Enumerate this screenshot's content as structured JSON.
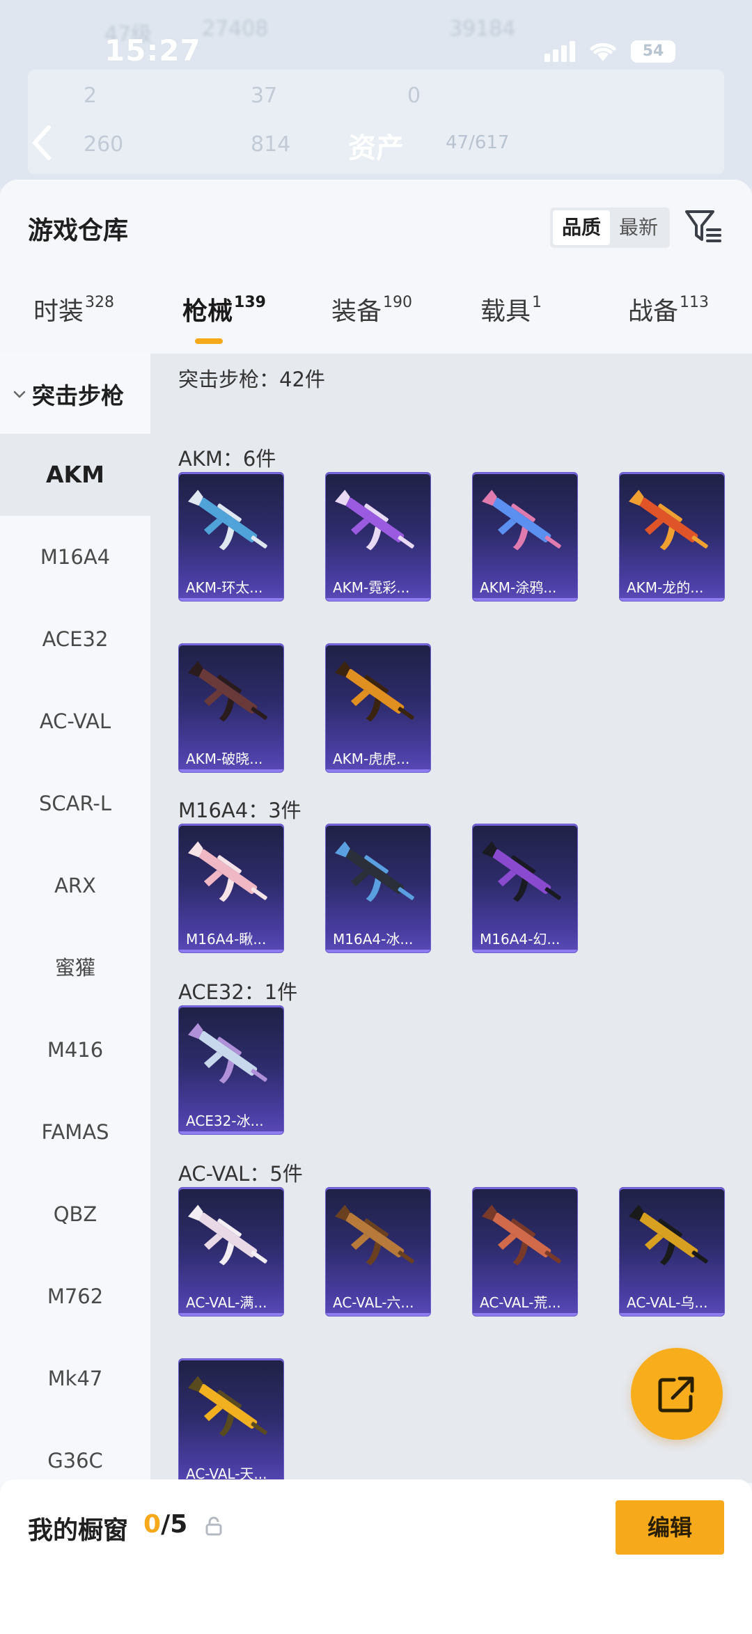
{
  "backdrop": {
    "faded_texts": [
      "47级",
      "27408",
      "39184",
      "2",
      "37",
      "0",
      "260",
      "814"
    ],
    "asset_title": "资产",
    "asset_count": "47/617"
  },
  "status_bar": {
    "time": "15:27",
    "battery": "54"
  },
  "warehouse": {
    "title": "游戏仓库",
    "sort_options": [
      "品质",
      "最新"
    ],
    "active_sort": "品质"
  },
  "tabs": [
    {
      "label": "时装",
      "count": "328"
    },
    {
      "label": "枪械",
      "count": "139"
    },
    {
      "label": "装备",
      "count": "190"
    },
    {
      "label": "载具",
      "count": "1"
    },
    {
      "label": "战备",
      "count": "113"
    }
  ],
  "sidebar": {
    "category": "突击步枪",
    "items": [
      "AKM",
      "M16A4",
      "ACE32",
      "AC-VAL",
      "SCAR-L",
      "ARX",
      "蜜獾",
      "M416",
      "FAMAS",
      "QBZ",
      "M762",
      "Mk47",
      "G36C"
    ]
  },
  "main": {
    "summary": "突击步枪：42件",
    "sections": [
      {
        "label": "AKM：6件",
        "items": [
          "AKM-环太...",
          "AKM-霓彩...",
          "AKM-涂鸦...",
          "AKM-龙的...",
          "AKM-破晓...",
          "AKM-虎虎..."
        ]
      },
      {
        "label": "M16A4：3件",
        "items": [
          "M16A4-瞅...",
          "M16A4-冰...",
          "M16A4-幻..."
        ]
      },
      {
        "label": "ACE32：1件",
        "items": [
          "ACE32-冰..."
        ]
      },
      {
        "label": "AC-VAL：5件",
        "items": [
          "AC-VAL-满...",
          "AC-VAL-六...",
          "AC-VAL-荒...",
          "AC-VAL-乌...",
          "AC-VAL-天..."
        ]
      }
    ]
  },
  "gun_colors": {
    "AKM-环太...": [
      "#4fa3d9",
      "#dfe8f0"
    ],
    "AKM-霓彩...": [
      "#9b5be0",
      "#e8d9f5"
    ],
    "AKM-涂鸦...": [
      "#5b8ff0",
      "#e07bb0"
    ],
    "AKM-龙的...": [
      "#e0542a",
      "#f0a030"
    ],
    "AKM-破晓...": [
      "#6a3a3a",
      "#2a1c1c"
    ],
    "AKM-虎虎...": [
      "#e09020",
      "#3a2410"
    ],
    "M16A4-瞅...": [
      "#f0b7c5",
      "#f6e3e8"
    ],
    "M16A4-冰...": [
      "#2a2f3a",
      "#5aa0e0"
    ],
    "M16A4-幻...": [
      "#8a4ad0",
      "#1a1a22"
    ],
    "ACE32-冰...": [
      "#c8d8ec",
      "#b090d8"
    ],
    "AC-VAL-满...": [
      "#e9d8e6",
      "#f3eef3"
    ],
    "AC-VAL-六...": [
      "#b87a3a",
      "#6a4020"
    ],
    "AC-VAL-荒...": [
      "#d06a4a",
      "#7a3a2a"
    ],
    "AC-VAL-乌...": [
      "#d8a020",
      "#1a1a1a"
    ],
    "AC-VAL-天...": [
      "#f0b020",
      "#5a4a20"
    ]
  },
  "bottom": {
    "showcase_label": "我的橱窗",
    "current": "0",
    "total": "/5",
    "edit_label": "编辑"
  },
  "colors": {
    "accent": "#f7a91c",
    "card_purple": "#4a3ea3"
  }
}
